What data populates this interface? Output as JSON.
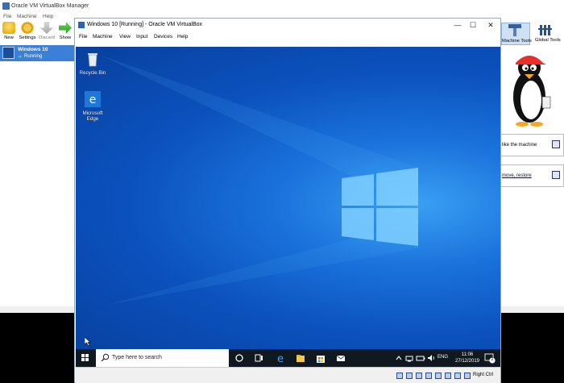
{
  "manager": {
    "title": "Oracle VM VirtualBox Manager",
    "menu": [
      "File",
      "Machine",
      "Help"
    ],
    "toolbar": [
      "New",
      "Settings",
      "Discard",
      "Show"
    ],
    "vm_list": [
      {
        "name": "Windows 10",
        "status": "Running"
      }
    ],
    "tools": {
      "machine_tools": "Machine Tools",
      "global_tools": "Global Tools"
    },
    "hints": [
      "like the machine",
      "move, restore"
    ]
  },
  "vm_window": {
    "title": "Windows 10 [Running] - Oracle VM VirtualBox",
    "menu": [
      "File",
      "Machine",
      "View",
      "Input",
      "Devices",
      "Help"
    ],
    "desktop_icons": [
      "Recycle Bin",
      "Microsoft Edge"
    ],
    "taskbar": {
      "search_placeholder": "Type here to search",
      "language": "ENG",
      "time": "11:06",
      "date": "27/12/2019",
      "notifications_count": "2"
    },
    "status_bar": {
      "host_key": "Right Ctrl"
    }
  },
  "colors": {
    "accent": "#3b7fd6",
    "desktop": "#0b51bd",
    "taskbar": "#101820"
  }
}
